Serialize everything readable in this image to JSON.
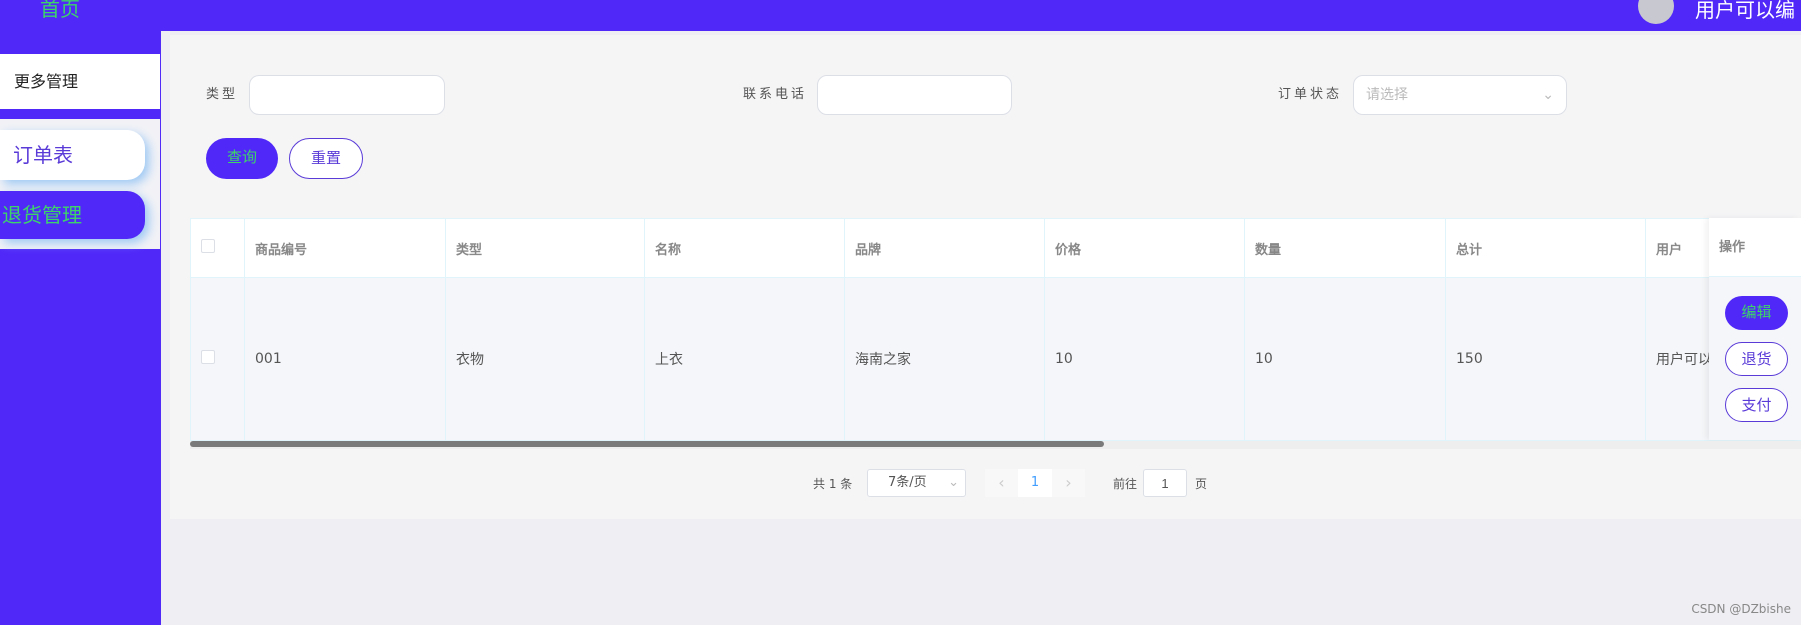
{
  "sidebar": {
    "home": "首页",
    "more": "更多管理",
    "items": [
      {
        "label": "订单表"
      },
      {
        "label": "退货管理"
      }
    ]
  },
  "header": {
    "user_text": "用户可以编"
  },
  "search": {
    "type_label": "类型",
    "phone_label": "联系电话",
    "status_label": "订单状态",
    "status_placeholder": "请选择",
    "query": "查询",
    "reset": "重置"
  },
  "table": {
    "columns": [
      "商品编号",
      "类型",
      "名称",
      "品牌",
      "价格",
      "数量",
      "总计",
      "用户",
      "操作"
    ],
    "rows": [
      {
        "id": "001",
        "type": "衣物",
        "name": "上衣",
        "brand": "海南之家",
        "price": "10",
        "qty": "10",
        "total": "150",
        "user": "用户可以"
      }
    ],
    "actions": {
      "edit": "编辑",
      "return": "退货",
      "pay": "支付"
    }
  },
  "pagination": {
    "total": "共 1 条",
    "page_size": "7条/页",
    "current": "1",
    "goto_label": "前往",
    "goto_value": "1",
    "page_suffix": "页",
    "prev": "‹",
    "next": "›"
  },
  "watermark": "CSDN @DZbishe",
  "colors": {
    "primary": "#5028f8",
    "accent_text": "#3dd46a"
  }
}
